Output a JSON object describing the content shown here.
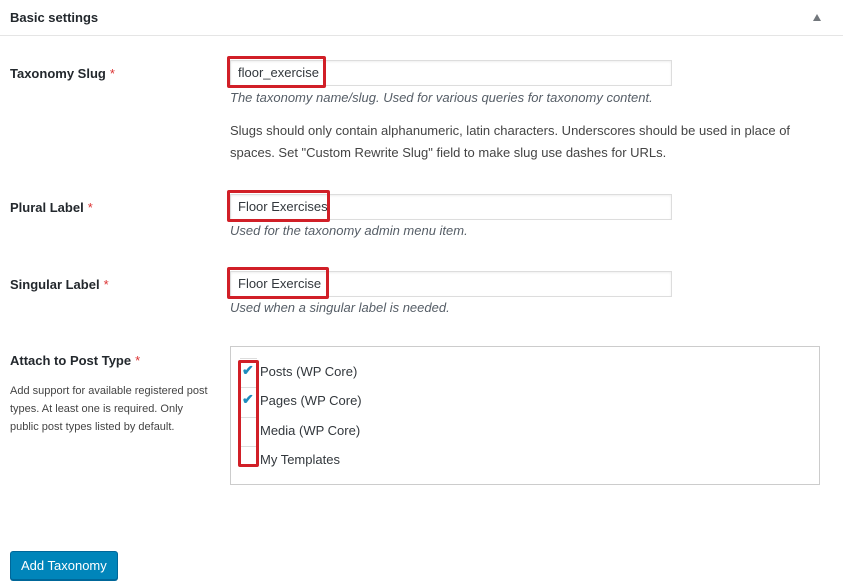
{
  "panel": {
    "title": "Basic settings",
    "toggle_icon": "triangle-up-icon"
  },
  "fields": {
    "slug": {
      "label": "Taxonomy Slug",
      "required_mark": "*",
      "value": "floor_exercise",
      "description": "The taxonomy name/slug. Used for various queries for taxonomy content.",
      "note": "Slugs should only contain alphanumeric, latin characters. Underscores should be used in place of spaces. Set \"Custom Rewrite Slug\" field to make slug use dashes for URLs."
    },
    "plural": {
      "label": "Plural Label",
      "required_mark": "*",
      "value": "Floor Exercises",
      "description": "Used for the taxonomy admin menu item."
    },
    "singular": {
      "label": "Singular Label",
      "required_mark": "*",
      "value": "Floor Exercise",
      "description": "Used when a singular label is needed."
    },
    "post_type": {
      "label": "Attach to Post Type",
      "required_mark": "*",
      "description": "Add support for available registered post types. At least one is required. Only public post types listed by default.",
      "options": [
        {
          "label": "Posts (WP Core)",
          "checked": true
        },
        {
          "label": "Pages (WP Core)",
          "checked": true
        },
        {
          "label": "Media (WP Core)",
          "checked": false
        },
        {
          "label": "My Templates",
          "checked": false
        }
      ]
    }
  },
  "actions": {
    "submit_label": "Add Taxonomy"
  },
  "colors": {
    "highlight": "#d11f27",
    "primary": "#0085ba",
    "check": "#1e8cbe",
    "required": "#dc3232"
  }
}
